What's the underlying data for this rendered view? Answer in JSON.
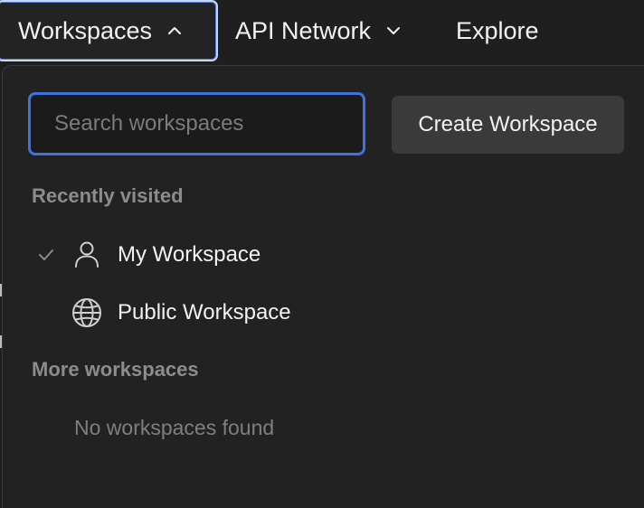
{
  "topnav": {
    "workspaces_label": "Workspaces",
    "api_network_label": "API Network",
    "explore_label": "Explore"
  },
  "workspace_menu": {
    "search_placeholder": "Search workspaces",
    "search_value": "",
    "create_button_label": "Create Workspace",
    "recent_section_label": "Recently visited",
    "recent_items": [
      {
        "label": "My Workspace",
        "icon": "person-icon",
        "selected": true
      },
      {
        "label": "Public Workspace",
        "icon": "globe-icon",
        "selected": false
      }
    ],
    "more_section_label": "More workspaces",
    "empty_message": "No workspaces found"
  },
  "colors": {
    "background": "#1f1f1f",
    "panel": "#222222",
    "focus_accent": "#3f73e0",
    "button_bg": "#3a3a3a",
    "muted_text": "#8c8c8c"
  }
}
